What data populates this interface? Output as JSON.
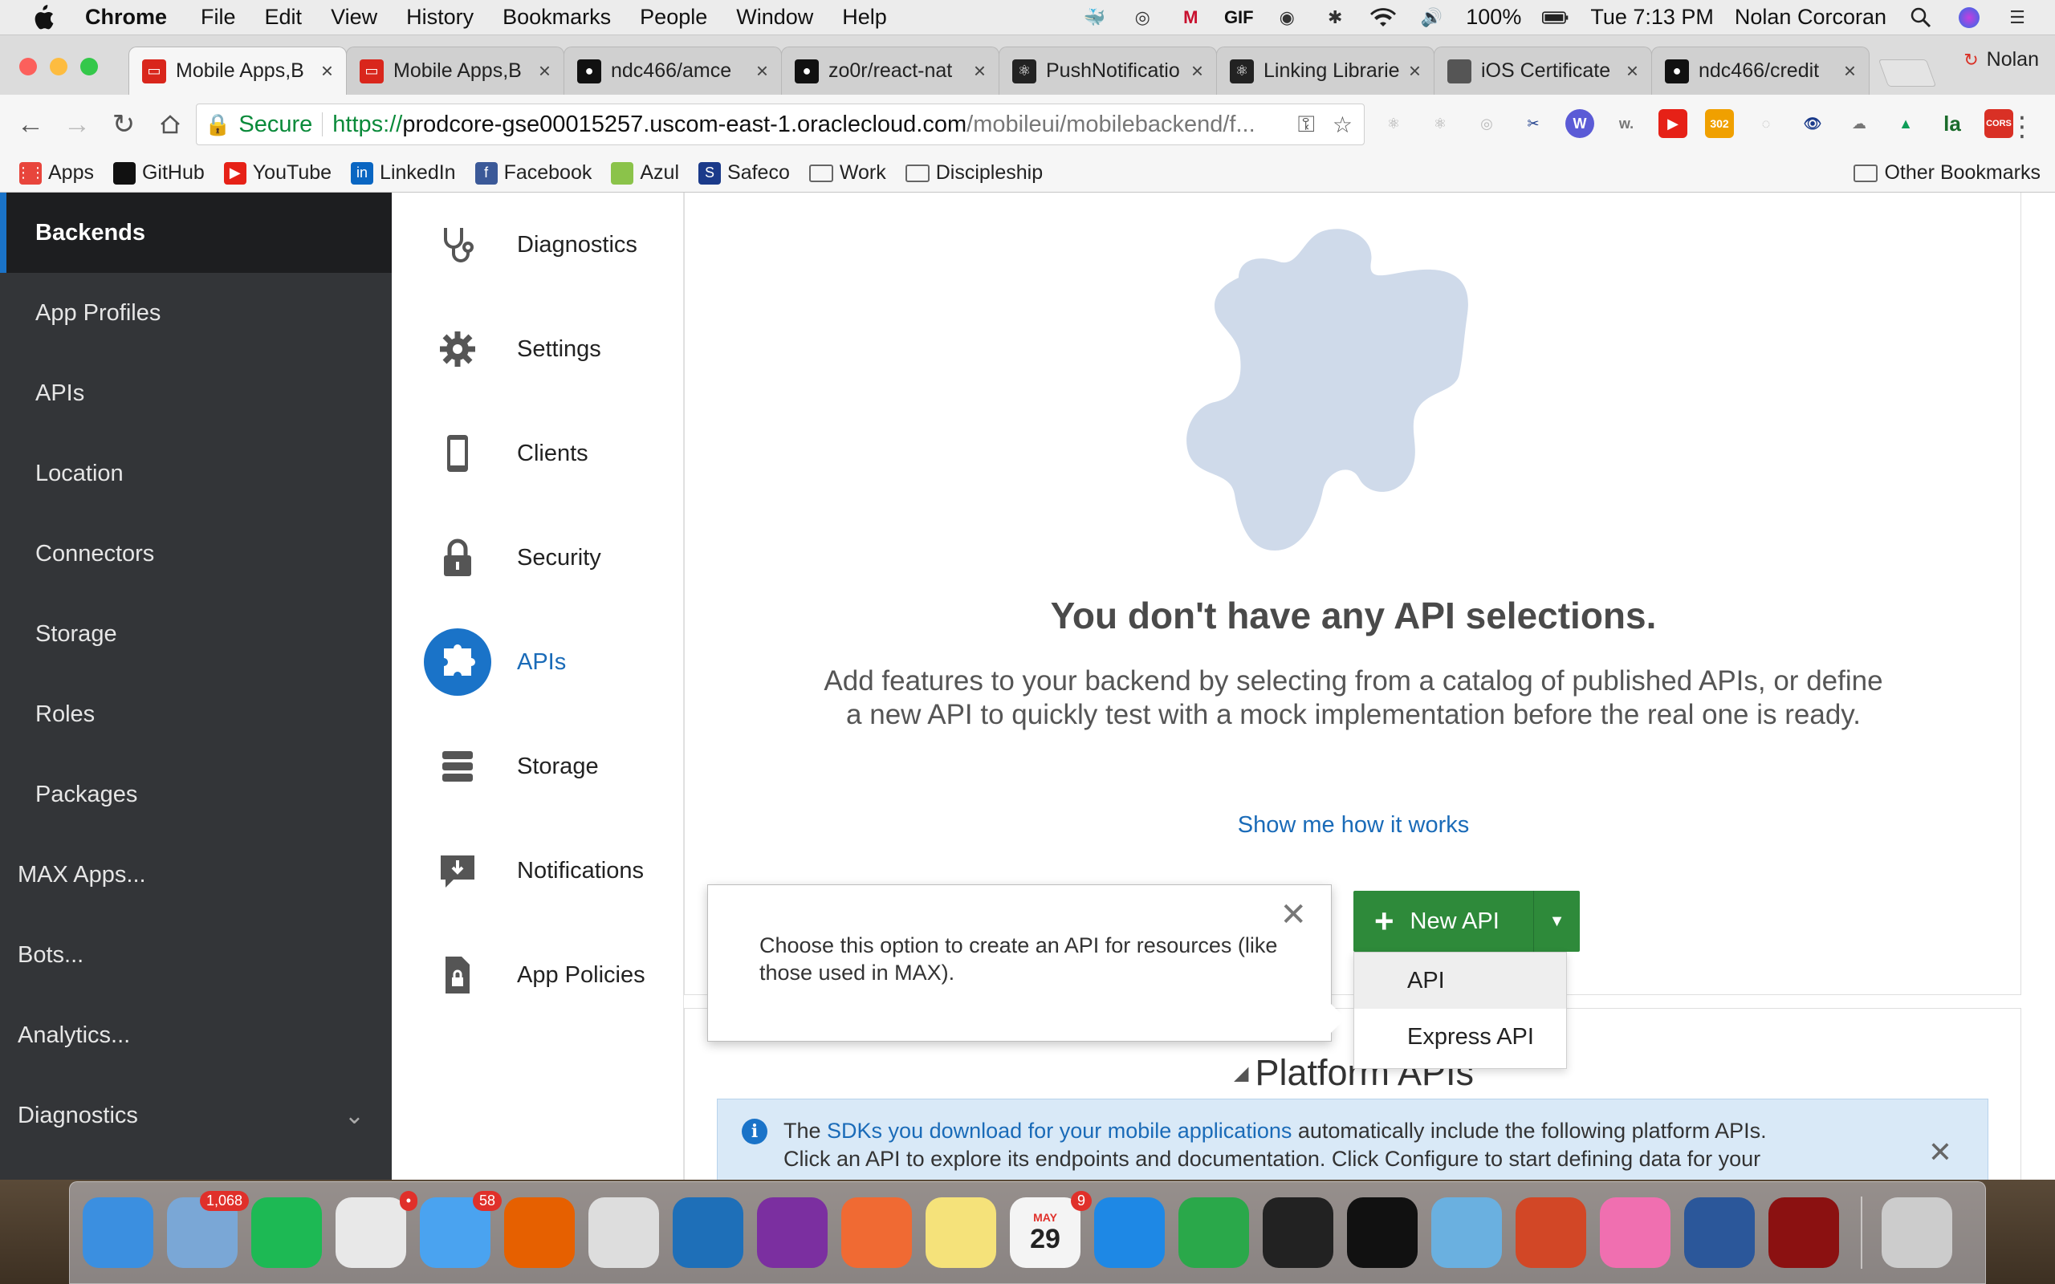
{
  "menubar": {
    "app": "Chrome",
    "items": [
      "File",
      "Edit",
      "View",
      "History",
      "Bookmarks",
      "People",
      "Window",
      "Help"
    ],
    "battery": "100%",
    "clock": "Tue 7:13 PM",
    "user": "Nolan Corcoran"
  },
  "tabs": [
    {
      "title": "Mobile Apps,B",
      "icon": "oracle-icon",
      "color": "#d9261c"
    },
    {
      "title": "Mobile Apps,B",
      "icon": "oracle-icon",
      "color": "#d9261c"
    },
    {
      "title": "ndc466/amce",
      "icon": "github-icon",
      "color": "#111111"
    },
    {
      "title": "zo0r/react-nat",
      "icon": "github-icon",
      "color": "#111111"
    },
    {
      "title": "PushNotificatio",
      "icon": "react-icon",
      "color": "#222222"
    },
    {
      "title": "Linking Librarie",
      "icon": "react-icon",
      "color": "#222222"
    },
    {
      "title": "iOS Certificate",
      "icon": "apple-icon",
      "color": "#555555"
    },
    {
      "title": "ndc466/credit",
      "icon": "github-icon",
      "color": "#111111"
    }
  ],
  "profile_name": "Nolan",
  "omnibox": {
    "secure": "Secure",
    "scheme": "https://",
    "host": "prodcore-gse00015257.uscom-east-1.oraclecloud.com",
    "path": "/mobileui/mobilebackend/f..."
  },
  "bookmarks": {
    "items": [
      {
        "label": "Apps",
        "icon": "apps-grid-icon",
        "color": "#e8453c"
      },
      {
        "label": "GitHub",
        "icon": "github-icon",
        "color": "#111111"
      },
      {
        "label": "YouTube",
        "icon": "youtube-icon",
        "color": "#e62117"
      },
      {
        "label": "LinkedIn",
        "icon": "linkedin-icon",
        "color": "#0a66c2"
      },
      {
        "label": "Facebook",
        "icon": "facebook-icon",
        "color": "#3b5998"
      },
      {
        "label": "Azul",
        "icon": "azul-icon",
        "color": "#8bc34a"
      },
      {
        "label": "Safeco",
        "icon": "safeco-icon",
        "color": "#1b3a8a"
      },
      {
        "label": "Work",
        "icon": "folder-icon",
        "color": "#666666"
      },
      {
        "label": "Discipleship",
        "icon": "folder-icon",
        "color": "#666666"
      }
    ],
    "other": "Other Bookmarks"
  },
  "sidebar": {
    "items": [
      {
        "label": "Backends",
        "active": true
      },
      {
        "label": "App Profiles"
      },
      {
        "label": "APIs"
      },
      {
        "label": "Location"
      },
      {
        "label": "Connectors"
      },
      {
        "label": "Storage"
      },
      {
        "label": "Roles"
      },
      {
        "label": "Packages"
      },
      {
        "label": "MAX Apps..."
      },
      {
        "label": "Bots..."
      },
      {
        "label": "Analytics..."
      },
      {
        "label": "Diagnostics"
      }
    ]
  },
  "subnav": {
    "items": [
      {
        "label": "Diagnostics",
        "icon": "stethoscope-icon"
      },
      {
        "label": "Settings",
        "icon": "gear-icon"
      },
      {
        "label": "Clients",
        "icon": "phone-icon"
      },
      {
        "label": "Security",
        "icon": "lock-icon"
      },
      {
        "label": "APIs",
        "icon": "puzzle-icon",
        "active": true
      },
      {
        "label": "Storage",
        "icon": "database-icon"
      },
      {
        "label": "Notifications",
        "icon": "notification-icon"
      },
      {
        "label": "App Policies",
        "icon": "document-lock-icon"
      }
    ]
  },
  "main": {
    "empty_title": "You don't have any API selections.",
    "empty_desc": "Add features to your backend by selecting from a catalog of published APIs, or define a new API to quickly test with a mock implementation before the real one is ready.",
    "show_link": "Show me how it works",
    "new_api_label": "New API",
    "dropdown": [
      "API",
      "Express API"
    ],
    "popover_text": "Choose this option to create an API for resources (like those used in MAX).",
    "platform_title": "Platform APIs",
    "info": {
      "pre": "The ",
      "link": "SDKs you download for your mobile applications",
      "post": " automatically include the following platform APIs.",
      "line2": "Click an API to explore its endpoints and documentation. Click Configure to start defining data for your"
    }
  },
  "dock": [
    {
      "name": "finder-icon",
      "color": "#3b8fe0"
    },
    {
      "name": "mail-icon",
      "color": "#7aa7d6",
      "badge": "1,068"
    },
    {
      "name": "spotify-icon",
      "color": "#1db954"
    },
    {
      "name": "slack-icon",
      "color": "#e8e8e8",
      "badge": "•"
    },
    {
      "name": "messages-icon",
      "color": "#4aa3f0",
      "badge": "58"
    },
    {
      "name": "firefox-icon",
      "color": "#e66000"
    },
    {
      "name": "chrome-icon",
      "color": "#dddddd"
    },
    {
      "name": "vscode-icon",
      "color": "#1e6fb8"
    },
    {
      "name": "onenote-icon",
      "color": "#7b2fa0"
    },
    {
      "name": "postman-icon",
      "color": "#f06a33"
    },
    {
      "name": "notes-icon",
      "color": "#f5e27a"
    },
    {
      "name": "calendar-icon",
      "color": "#f4f4f4",
      "badge": "9"
    },
    {
      "name": "app-store-icon",
      "color": "#1e88e5"
    },
    {
      "name": "network-icon",
      "color": "#2aa84a"
    },
    {
      "name": "terminal-icon",
      "color": "#222222"
    },
    {
      "name": "activity-monitor-icon",
      "color": "#111111"
    },
    {
      "name": "pinwheel-icon",
      "color": "#6ab0e0"
    },
    {
      "name": "powerpoint-icon",
      "color": "#d24726"
    },
    {
      "name": "itunes-icon",
      "color": "#f06fb0"
    },
    {
      "name": "word-icon",
      "color": "#2b579a"
    },
    {
      "name": "acrobat-icon",
      "color": "#8b1111"
    },
    {
      "name": "trash-icon",
      "color": "#cccccc"
    }
  ],
  "calendar": {
    "month": "MAY",
    "day": "29"
  }
}
